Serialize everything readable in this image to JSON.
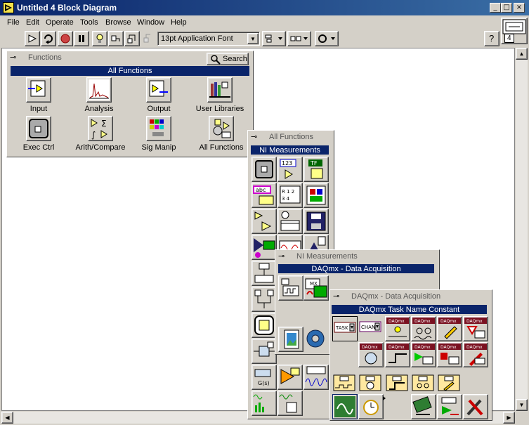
{
  "window": {
    "title": "Untitled 4 Block Diagram",
    "connector_number": "4"
  },
  "menu": [
    {
      "label": "File"
    },
    {
      "label": "Edit"
    },
    {
      "label": "Operate"
    },
    {
      "label": "Tools"
    },
    {
      "label": "Browse"
    },
    {
      "label": "Window"
    },
    {
      "label": "Help"
    }
  ],
  "toolbar": {
    "font_select": "13pt Application Font",
    "help": "?"
  },
  "functions_palette": {
    "title": "Functions",
    "search_label": "Search",
    "banner": "All Functions",
    "items": [
      {
        "label": "Input",
        "icon": "input-icon"
      },
      {
        "label": "Analysis",
        "icon": "analysis-icon"
      },
      {
        "label": "Output",
        "icon": "output-icon"
      },
      {
        "label": "User Libraries",
        "icon": "user-libraries-icon"
      },
      {
        "label": "Exec Ctrl",
        "icon": "exec-ctrl-icon"
      },
      {
        "label": "Arith/Compare",
        "icon": "arith-compare-icon"
      },
      {
        "label": "Sig Manip",
        "icon": "sig-manip-icon"
      },
      {
        "label": "All Functions",
        "icon": "all-functions-icon"
      }
    ]
  },
  "all_functions_palette": {
    "title": "All Functions",
    "banner": "NI Measurements"
  },
  "ni_measurements_palette": {
    "title": "NI Measurements",
    "banner": "DAQmx - Data Acquisition"
  },
  "daqmx_palette": {
    "title": "DAQmx - Data Acquisition",
    "banner": "DAQmx Task Name Constant",
    "task_label": "TASK",
    "chan_label": "CHAN",
    "daq_label": "DAQmx"
  },
  "colors": {
    "title_bar": "#0a246a",
    "banner": "#0a246a",
    "face": "#d4d0c8",
    "daq_tag": "#7a1020"
  }
}
